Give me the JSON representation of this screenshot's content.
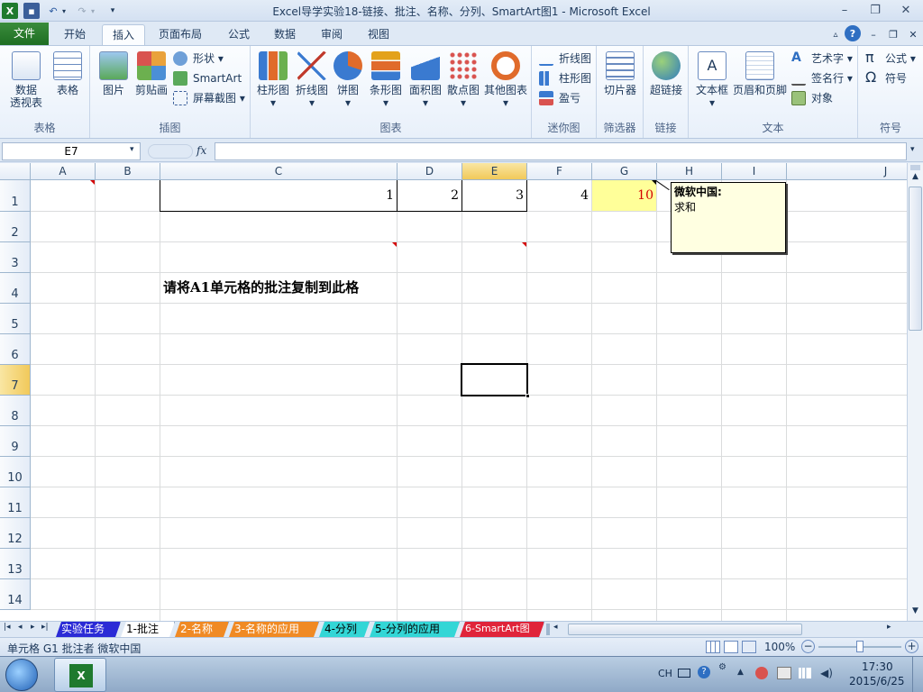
{
  "title": "Excel导学实验18-链接、批注、名称、分列、SmartArt图1  -  Microsoft Excel",
  "tabs": [
    "文件",
    "开始",
    "插入",
    "页面布局",
    "公式",
    "数据",
    "审阅",
    "视图"
  ],
  "ribbon": {
    "groups": {
      "tables": "表格",
      "illustrations": "插图",
      "charts": "图表",
      "sparklines": "迷你图",
      "filter": "筛选器",
      "links": "链接",
      "text": "文本",
      "symbols": "符号"
    },
    "pivot_line1": "数据",
    "pivot_line2": "透视表",
    "table": "表格",
    "picture": "图片",
    "clipart": "剪贴画",
    "shapes": "形状",
    "smartart": "SmartArt",
    "screenshot": "屏幕截图",
    "column": "柱形图",
    "line": "折线图",
    "pie": "饼图",
    "bar": "条形图",
    "area": "面积图",
    "scatter": "散点图",
    "other": "其他图表",
    "spark_line": "折线图",
    "spark_column": "柱形图",
    "spark_winloss": "盈亏",
    "slicer": "切片器",
    "hyperlink": "超链接",
    "textbox": "文本框",
    "header_footer": "页眉和页脚",
    "wordart": "艺术字",
    "signature": "签名行",
    "object": "对象",
    "equation": "公式",
    "symbol": "符号"
  },
  "formula_bar": {
    "name_box": "E7",
    "fx": "fx",
    "formula": ""
  },
  "columns": [
    "A",
    "B",
    "C",
    "D",
    "E",
    "F",
    "G",
    "H",
    "I",
    "J"
  ],
  "rows": [
    "1",
    "2",
    "3",
    "4",
    "5",
    "6",
    "7",
    "8",
    "9",
    "10",
    "11",
    "12",
    "13",
    "14"
  ],
  "cells": {
    "C1": "1",
    "D1": "2",
    "E1": "3",
    "F1": "4",
    "G1": "10",
    "C4": "请将A1单元格的批注复制到此格"
  },
  "comment": {
    "author": "微软中国:",
    "text": "求和"
  },
  "sheet_tabs": [
    "实验任务",
    "1-批注",
    "2-名称",
    "3-名称的应用",
    "4-分列",
    "5-分列的应用",
    "6-SmartArt图"
  ],
  "status": {
    "text": "单元格 G1 批注者 微软中国",
    "zoom": "100%"
  },
  "taskbar": {
    "lang": "CH",
    "time": "17:30",
    "date": "2015/6/25"
  },
  "colors": {
    "accent": "#f1c95a",
    "file_tab": "#2a7d2e",
    "comment_bg": "#ffffe1",
    "comment_indicator": "#d40000"
  }
}
